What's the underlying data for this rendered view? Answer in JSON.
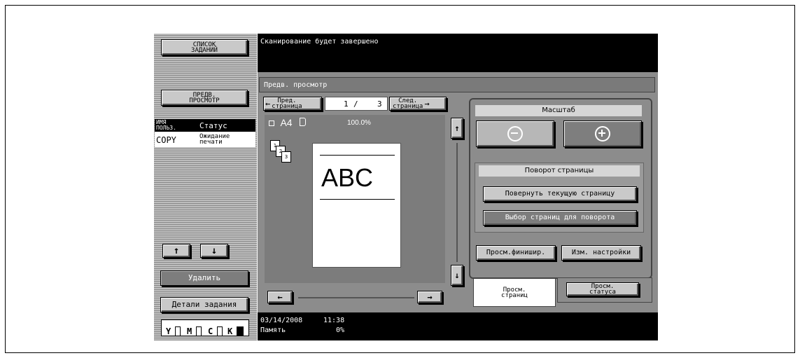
{
  "left": {
    "job_list_btn": "СПИСОК\nЗАДАНИЙ",
    "preview_btn": "ПРЕДВ.\nПРОСМОТР",
    "table": {
      "col_user": "ИМЯ\nПОЛЬЗ.",
      "col_status": "Статус",
      "row_user": "COPY",
      "row_status": "Ожидание\nпечати"
    },
    "up_arrow": "↑",
    "down_arrow": "↓",
    "delete_btn": "Удалить",
    "details_btn": "Детали задания",
    "toner": [
      "Y",
      "M",
      "C",
      "K"
    ]
  },
  "top": {
    "message": "Сканирование будет завершено"
  },
  "preview": {
    "title": "Предв. просмотр",
    "prev_page_btn": "Пред.\nстраница",
    "page_current": "1",
    "page_sep": "/",
    "page_total": "3",
    "next_page_btn": "След.\nстраница",
    "paper": "A4",
    "zoom": "100.0%",
    "page_text": "ABC",
    "left_arrow": "←",
    "right_arrow": "→"
  },
  "right": {
    "scale_label": "Масштаб",
    "rotate_label": "Поворот страницы",
    "rotate_current_btn": "Повернуть текущую страницу",
    "select_pages_btn": "Выбор страниц для поворота",
    "finish_btn": "Просм.финишир.",
    "change_settings_btn": "Изм. настройки",
    "tab_pages": "Просм.\nстраниц",
    "tab_status": "Просм.\nстатуса"
  },
  "status": {
    "date": "03/14/2008",
    "time": "11:38",
    "memory_label": "Память",
    "memory_value": "0%"
  },
  "colors": {
    "panel_gray": "#8c8c8c",
    "screen_black": "#000000",
    "button_gray": "#c9c9c9"
  }
}
